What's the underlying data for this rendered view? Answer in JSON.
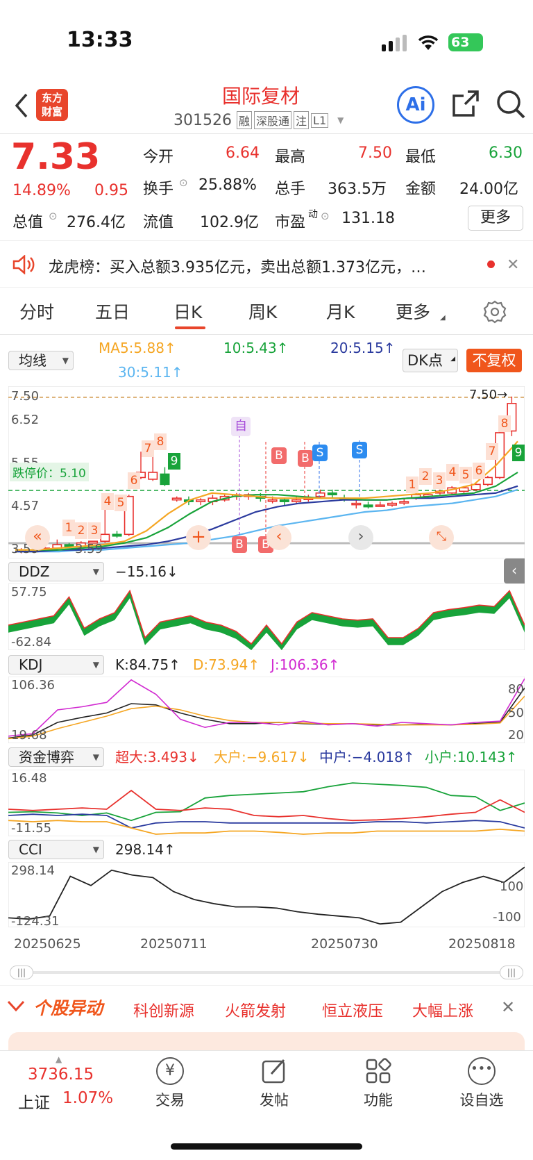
{
  "status_bar": {
    "time": "13:33",
    "battery": "63"
  },
  "header": {
    "logo_line1": "东方",
    "logo_line2": "财富",
    "stock_name": "国际复材",
    "stock_code": "301526",
    "badges": [
      "融",
      "深股通",
      "注",
      "L1"
    ],
    "ai_label": "Ai"
  },
  "quote": {
    "price": "7.33",
    "change_pct": "14.89%",
    "change_abs": "0.95",
    "open_label": "今开",
    "open": "6.64",
    "high_label": "最高",
    "high": "7.50",
    "low_label": "最低",
    "low": "6.30",
    "turnover_label": "换手",
    "turnover": "25.88%",
    "volume_label": "总手",
    "volume": "363.5万",
    "amount_label": "金额",
    "amount": "24.00亿",
    "mktcap_label": "总值",
    "mktcap": "276.4亿",
    "float_label": "流值",
    "float_cap": "102.9亿",
    "pe_label": "市盈",
    "pe_sup": "动",
    "pe": "131.18",
    "more_label": "更多"
  },
  "notice": {
    "text": "龙虎榜：买入总额3.935亿元，卖出总额1.373亿元，…"
  },
  "tabs": [
    {
      "label": "分时",
      "active": false
    },
    {
      "label": "五日",
      "active": false
    },
    {
      "label": "日K",
      "active": true
    },
    {
      "label": "周K",
      "active": false
    },
    {
      "label": "月K",
      "active": false
    },
    {
      "label": "更多",
      "active": false
    }
  ],
  "ma_bar": {
    "selector": "均线",
    "ma5": "MA5:5.88↑",
    "ma10": "10:5.43↑",
    "ma20": "20:5.15↑",
    "ma30": "30:5.11↑",
    "dk_label": "DK点",
    "fq_label": "不复权",
    "colors": {
      "ma5": "#f5a623",
      "ma10": "#18a33a",
      "ma20": "#2a3a9e",
      "ma30": "#5bb5f0"
    }
  },
  "kline": {
    "y_labels": [
      "7.50",
      "6.52",
      "5.55",
      "4.57",
      "3.59"
    ],
    "high_marker": "7.50",
    "limit_down_label": "跌停价：5.10",
    "sub_price": "3.59"
  },
  "indicators": {
    "ddz": {
      "name": "DDZ",
      "value": "−15.16↓",
      "max": "57.75",
      "min": "-62.84"
    },
    "kdj": {
      "name": "KDJ",
      "k": "K:84.75↑",
      "d": "D:73.94↑",
      "j": "J:106.36↑",
      "max": "106.36",
      "min": "19.68",
      "levels": [
        "80",
        "50",
        "20"
      ]
    },
    "zjby": {
      "name": "资金博弈",
      "cd": "超大:3.493↓",
      "dh": "大户:−9.617↓",
      "zh": "中户:−4.018↑",
      "xh": "小户:10.143↑",
      "max": "16.48",
      "min": "-11.55"
    },
    "cci": {
      "name": "CCI",
      "value": "298.14↑",
      "max": "298.14",
      "min": "-124.31",
      "levels": [
        "100",
        "-100"
      ]
    }
  },
  "dates": [
    "20250625",
    "20250711",
    "20250730",
    "20250818"
  ],
  "anomaly": {
    "title": "个股异动",
    "tags": [
      "科创新源",
      "火箭发射",
      "恒立液压",
      "大幅上涨"
    ]
  },
  "bottom_nav": {
    "index_value": "3736.15",
    "index_name": "上证",
    "index_change": "1.07%",
    "items": [
      {
        "label": "交易",
        "icon": "yen-coin-icon"
      },
      {
        "label": "发帖",
        "icon": "edit-post-icon"
      },
      {
        "label": "功能",
        "icon": "grid-apps-icon"
      },
      {
        "label": "设自选",
        "icon": "more-dots-icon"
      }
    ]
  }
}
